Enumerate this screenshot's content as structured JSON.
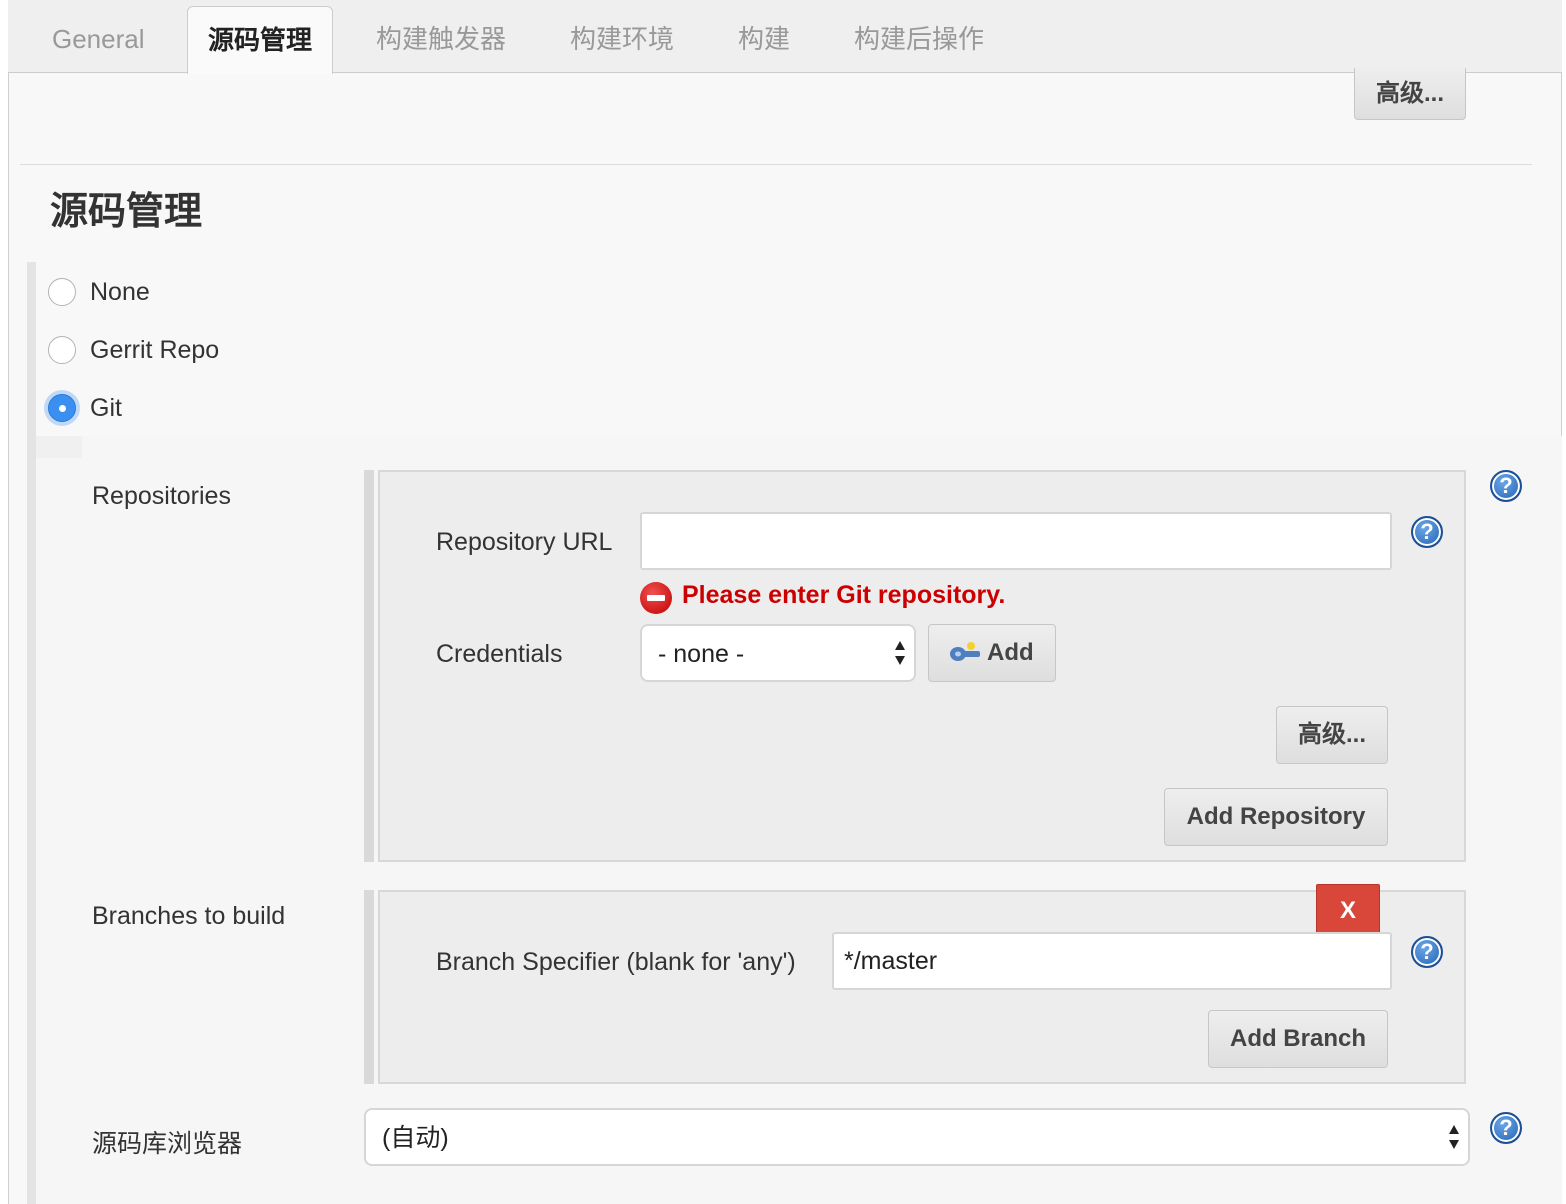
{
  "tabs": [
    {
      "label": "General",
      "active": false
    },
    {
      "label": "源码管理",
      "active": true
    },
    {
      "label": "构建触发器",
      "active": false
    },
    {
      "label": "构建环境",
      "active": false
    },
    {
      "label": "构建",
      "active": false
    },
    {
      "label": "构建后操作",
      "active": false
    }
  ],
  "top_advanced_label": "高级...",
  "section_title": "源码管理",
  "scm_options": [
    {
      "label": "None",
      "selected": false
    },
    {
      "label": "Gerrit Repo",
      "selected": false
    },
    {
      "label": "Git",
      "selected": true
    }
  ],
  "repositories": {
    "label": "Repositories",
    "url_label": "Repository URL",
    "url_value": "",
    "error": "Please enter Git repository.",
    "credentials_label": "Credentials",
    "credentials_value": "- none -",
    "add_label": "Add",
    "advanced_label": "高级...",
    "add_repository_label": "Add Repository"
  },
  "branches": {
    "label": "Branches to build",
    "delete_label": "X",
    "specifier_label": "Branch Specifier (blank for 'any')",
    "specifier_value": "*/master",
    "add_branch_label": "Add Branch"
  },
  "browser": {
    "label": "源码库浏览器",
    "value": "(自动)"
  },
  "help_glyph": "?",
  "colors": {
    "error": "#cc0000",
    "delete_button": "#d9473b",
    "radio_selected": "#3a8ff0"
  }
}
